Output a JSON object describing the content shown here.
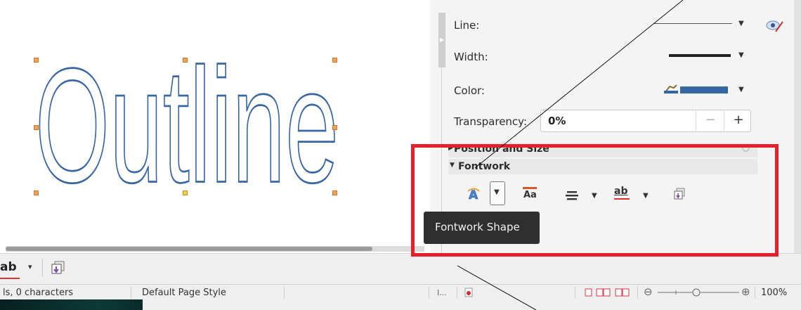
{
  "document": {
    "fontwork_text": "Outline",
    "outline_color": "#3a67a0"
  },
  "sidebar": {
    "line_label": "Line:",
    "width_label": "Width:",
    "color_label": "Color:",
    "transparency_label": "Transparency:",
    "transparency_value": "0%",
    "transparency_minus": "−",
    "transparency_plus": "+",
    "color_value": "#3465a4",
    "panels": {
      "position_and_size": "Position and Size",
      "fontwork": "Fontwork"
    },
    "fontwork_toolbar": {
      "tooltip": "Fontwork Shape",
      "same_height_glyph": "Aa",
      "spacing_glyph": "ab"
    }
  },
  "bottom_toolbar": {
    "spacing_glyph": "ab"
  },
  "statusbar": {
    "word_count": "ls, 0 characters",
    "page_style": "Default Page Style",
    "zoom": "100%",
    "insert_mode_glyph": "I..."
  },
  "colors": {
    "annotation_red": "#e6202b",
    "tooltip_bg": "#2f2f2f"
  }
}
